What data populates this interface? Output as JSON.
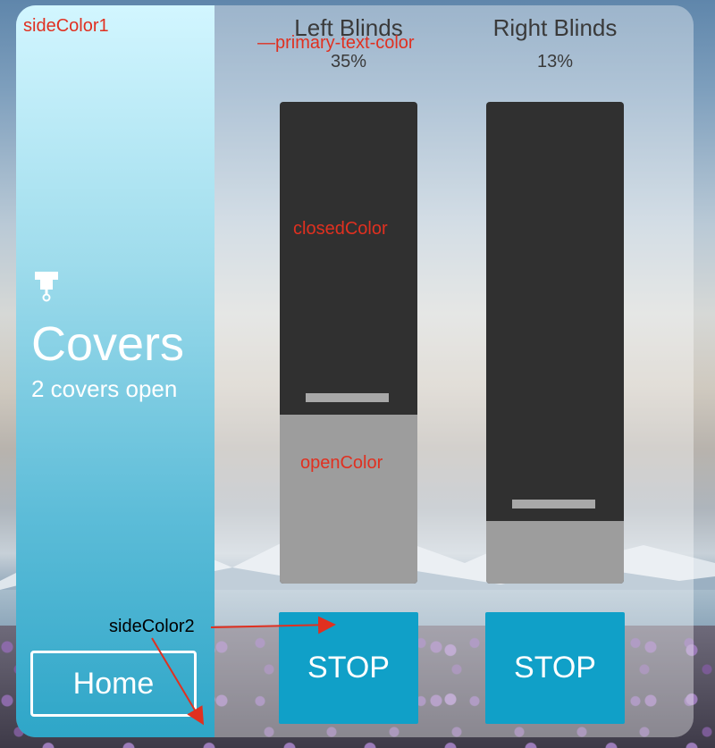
{
  "side": {
    "icon": "window-shade-icon",
    "title": "Covers",
    "subtitle": "2 covers open",
    "home_label": "Home"
  },
  "covers": [
    {
      "name": "Left Blinds",
      "position_text": "35%",
      "position": 0.35,
      "stop_label": "STOP"
    },
    {
      "name": "Right Blinds",
      "position_text": "13%",
      "position": 0.13,
      "stop_label": "STOP"
    }
  ],
  "annotations": {
    "side_color_1": "sideColor1",
    "primary_text_color": "—primary-text-color",
    "closed_color": "closedColor",
    "open_color": "openColor",
    "side_color_2": "sideColor2"
  },
  "colors": {
    "closed": "#303030",
    "open": "#9d9d9d",
    "stop_button": "#10a0c8",
    "annotation": "#e03020"
  }
}
